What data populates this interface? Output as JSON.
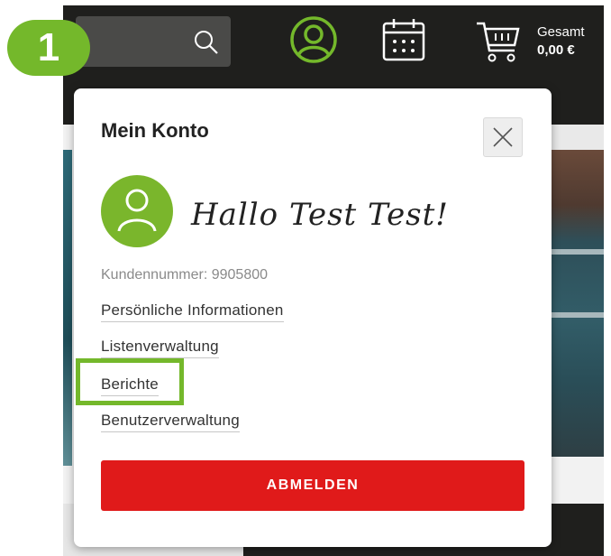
{
  "header": {
    "search_icon": "search-icon",
    "account_icon": "account-circle-icon",
    "calendar_icon": "calendar-icon",
    "cart_icon": "shopping-cart-icon",
    "cart_label": "Gesamt",
    "cart_total": "0,00 €"
  },
  "annotation": {
    "step_number": "1",
    "accent_color": "#74b82b"
  },
  "account_panel": {
    "title": "Mein Konto",
    "close_icon": "close-icon",
    "avatar_icon": "user-icon",
    "greeting": "Hallo Test Test!",
    "customer_number": "Kundennummer: 9905800",
    "links": [
      {
        "label": "Persönliche Informationen"
      },
      {
        "label": "Listenverwaltung"
      },
      {
        "label": "Berichte"
      },
      {
        "label": "Benutzerverwaltung"
      }
    ],
    "logout_label": "ABMELDEN",
    "logout_color": "#e01a1a"
  }
}
